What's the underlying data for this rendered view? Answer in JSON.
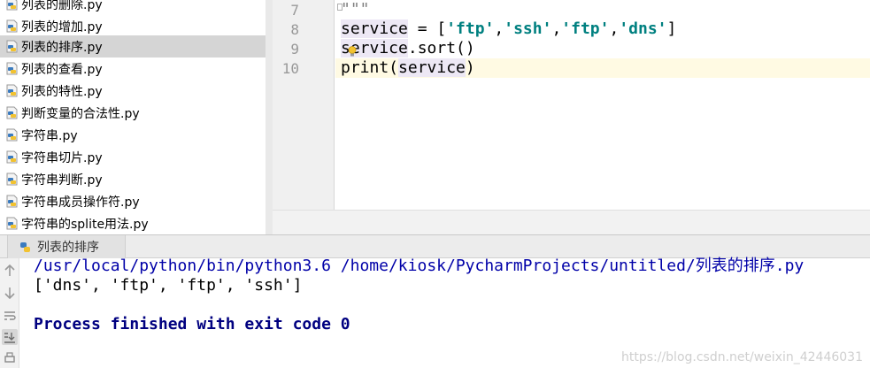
{
  "project_tree": {
    "items": [
      {
        "label": "列表的删除.py"
      },
      {
        "label": "列表的增加.py"
      },
      {
        "label": "列表的排序.py"
      },
      {
        "label": "列表的查看.py"
      },
      {
        "label": "列表的特性.py"
      },
      {
        "label": "判断变量的合法性.py"
      },
      {
        "label": "字符串.py"
      },
      {
        "label": "字符串切片.py"
      },
      {
        "label": "字符串判断.py"
      },
      {
        "label": "字符串成员操作符.py"
      },
      {
        "label": "字符串的splite用法.py"
      }
    ],
    "selected_index": 2,
    "file_icon": "python-file-icon"
  },
  "editor": {
    "line_numbers": [
      "7",
      "8",
      "9",
      "10"
    ],
    "current_line": "10",
    "lines": {
      "l7": "\"\"\"",
      "l8": {
        "var": "service",
        "eq": " = [",
        "s1": "'ftp'",
        "c1": ",",
        "s2": "'ssh'",
        "c2": ",",
        "s3": "'ftp'",
        "c3": ",",
        "s4": "'dns'",
        "end": "]"
      },
      "l9": {
        "var": "service",
        "rest": ".sort()"
      },
      "l10": {
        "fn": "print(",
        "var": "service",
        "end": ")"
      }
    },
    "gutter_icon": "intention-bulb-icon"
  },
  "run_panel": {
    "tab_label": "列表的排序",
    "tab_icon": "python-file-icon",
    "toolbar_icons": [
      "arrow-up-icon",
      "arrow-down-icon",
      "soft-wrap-icon",
      "scroll-to-end-icon",
      "print-icon"
    ],
    "console": {
      "command_line": "/usr/local/python/bin/python3.6 /home/kiosk/PycharmProjects/untitled/列表的排序.py",
      "output_line": "['dns', 'ftp', 'ftp', 'ssh']",
      "status_line": "Process finished with exit code 0"
    },
    "watermark": "https://blog.csdn.net/weixin_42446031"
  },
  "colors": {
    "selected_row": "#d5d5d5",
    "current_line": "#fffae3",
    "string": "#008080",
    "console_command": "#0000a8",
    "console_status": "#000080"
  }
}
